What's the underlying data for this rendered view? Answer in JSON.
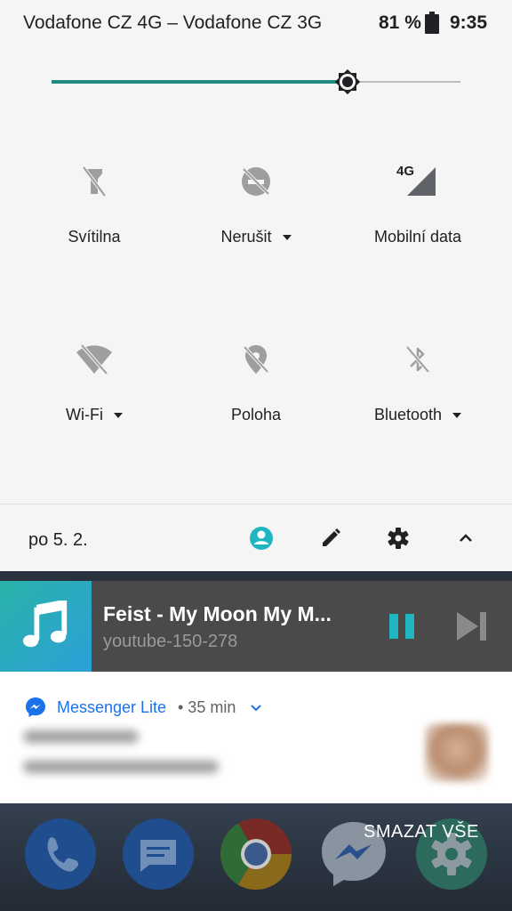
{
  "status_bar": {
    "carrier": "Vodafone CZ 4G – Vodafone CZ 3G",
    "battery": "81 %",
    "time": "9:35"
  },
  "brightness": {
    "level": 0.72
  },
  "quick_settings": [
    {
      "id": "flashlight",
      "label": "Svítilna",
      "icon": "flashlight-off-icon",
      "dropdown": false
    },
    {
      "id": "dnd",
      "label": "Nerušit",
      "icon": "do-not-disturb-off-icon",
      "dropdown": true
    },
    {
      "id": "mobile-data",
      "label": "Mobilní data",
      "icon": "signal-4g-icon",
      "dropdown": false,
      "badge": "4G"
    },
    {
      "id": "wifi",
      "label": "Wi-Fi",
      "icon": "wifi-off-icon",
      "dropdown": true
    },
    {
      "id": "location",
      "label": "Poloha",
      "icon": "location-off-icon",
      "dropdown": false
    },
    {
      "id": "bluetooth",
      "label": "Bluetooth",
      "icon": "bluetooth-off-icon",
      "dropdown": true
    }
  ],
  "footer": {
    "date": "po 5. 2."
  },
  "media": {
    "title": "Feist - My Moon My M...",
    "source": "youtube-150-278",
    "accent": "#1fb6c1"
  },
  "notification": {
    "app": "Messenger Lite",
    "time": "• 35 min",
    "accent": "#1a73e8"
  },
  "dock": {
    "clear_all": "SMAZAT VŠE",
    "apps": [
      "phone-icon",
      "messages-icon",
      "chrome-icon",
      "messenger-icon",
      "settings-icon"
    ]
  }
}
